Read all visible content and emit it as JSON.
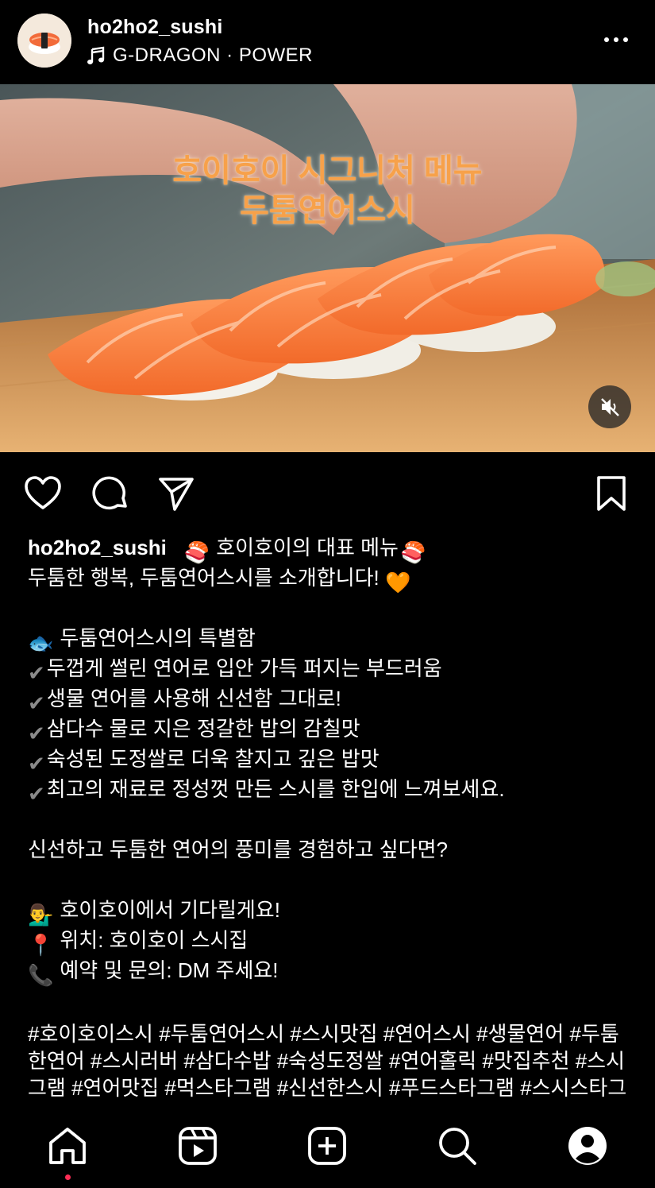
{
  "header": {
    "username": "ho2ho2_sushi",
    "music": "G-DRAGON · POWER"
  },
  "media": {
    "overlay_line1": "호이호이 시그니처 메뉴",
    "overlay_line2": "두툼연어스시"
  },
  "caption": {
    "username": "ho2ho2_sushi",
    "l1": "호이호이의 대표 메뉴",
    "l2": "두툼한 행복, 두툼연어스시를 소개합니다!",
    "l3": "두툼연어스시의 특별함",
    "c1": "두껍게 썰린 연어로 입안 가득 퍼지는 부드러움",
    "c2": "생물 연어를 사용해 신선함 그대로!",
    "c3": "삼다수 물로 지은 정갈한 밥의 감칠맛",
    "c4": "숙성된 도정쌀로 더욱 찰지고 깊은 밥맛",
    "c5": "최고의 재료로 정성껏 만든 스시를 한입에 느껴보세요.",
    "question": "신선하고 두툼한 연어의 풍미를 경험하고 싶다면?",
    "wait": "호이호이에서 기다릴게요!",
    "location": "위치: 호이호이 스시집",
    "contact": "예약 및 문의: DM 주세요!",
    "hashtags": "#호이호이스시 #두툼연어스시 #스시맛집 #연어스시 #생물연어 #두툼한연어 #스시러버 #삼다수밥 #숙성도정쌀 #연어홀릭 #맛집추천 #스시그램 #연어맛집 #먹스타그램 #신선한스시 #푸드스타그램 #스시스타그램 #일식맛집"
  },
  "colors": {
    "overlay_text": "#f7a14a",
    "background": "#000000",
    "notification_dot": "#ff2d55"
  },
  "icons": [
    "more-icon",
    "music-note-icon",
    "mute-icon",
    "heart-icon",
    "comment-icon",
    "share-icon",
    "bookmark-icon",
    "home-icon",
    "reels-icon",
    "create-icon",
    "search-icon",
    "profile-icon"
  ]
}
